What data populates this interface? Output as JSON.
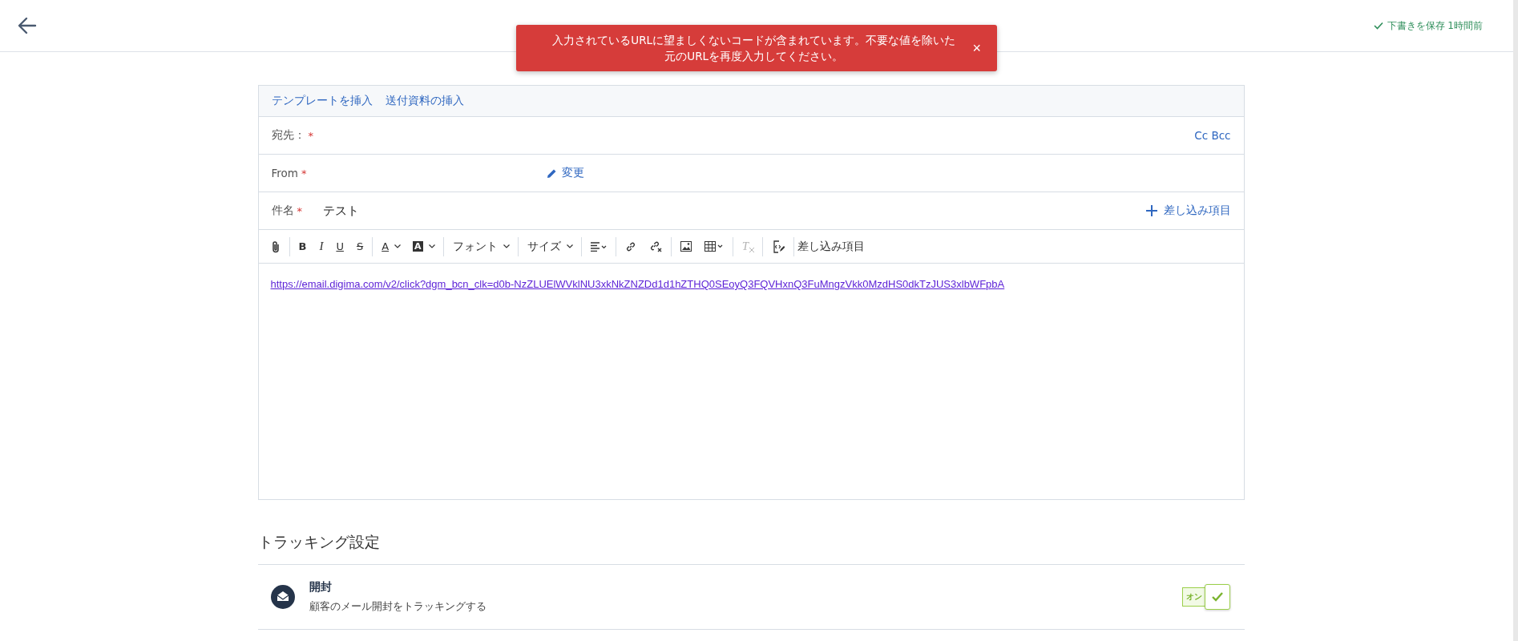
{
  "header": {
    "save_status": "下書きを保存 1時間前"
  },
  "toast": {
    "message": "入力されているURLに望ましくないコードが含まれています。不要な値を除いた元のURLを再度入力してください。",
    "close": "×"
  },
  "compose": {
    "links": [
      "テンプレートを挿入",
      "送付資料の挿入"
    ],
    "to": {
      "label": "宛先：",
      "required_mark": "*",
      "cc_bcc": "Cc Bcc"
    },
    "from": {
      "label": "From",
      "required_mark": "*",
      "change": "変更"
    },
    "subject": {
      "label": "件名",
      "required_mark": "*",
      "value": "テスト",
      "insert": "差し込み項目"
    },
    "toolbar": [
      [
        {
          "kind": "attach"
        }
      ],
      [
        {
          "kind": "bold",
          "label": "B"
        },
        {
          "kind": "italic",
          "label": "I"
        },
        {
          "kind": "underline",
          "label": "U"
        },
        {
          "kind": "strike",
          "label": "S"
        }
      ],
      [
        {
          "kind": "color",
          "label": "A"
        },
        {
          "kind": "highlight",
          "label": "A"
        }
      ],
      [
        {
          "kind": "menu",
          "label": "フォント"
        }
      ],
      [
        {
          "kind": "menu",
          "label": "サイズ"
        }
      ],
      [
        {
          "kind": "align"
        }
      ],
      [
        {
          "kind": "link"
        },
        {
          "kind": "unlink"
        }
      ],
      [
        {
          "kind": "image"
        },
        {
          "kind": "table"
        }
      ],
      [
        {
          "kind": "clear",
          "label": "T",
          "disabled": true
        }
      ],
      [
        {
          "kind": "merge"
        }
      ],
      [
        {
          "kind": "text",
          "label": "差し込み項目"
        }
      ]
    ],
    "body_link": "https://email.digima.com/v2/click?dgm_bcn_clk=d0b-NzZLUElWVklNU3xkNkZNZDd1d1hZTHQ0SEoyQ3FQVHxnQ3FuMngzVkk0MzdHS0dkTzJUS3xlbWFpbA"
  },
  "tracking": {
    "heading": "トラッキング設定",
    "items": [
      {
        "title": "開封",
        "description": "顧客のメール開封をトラッキングする",
        "toggle_label": "オン",
        "on": true
      }
    ]
  }
}
